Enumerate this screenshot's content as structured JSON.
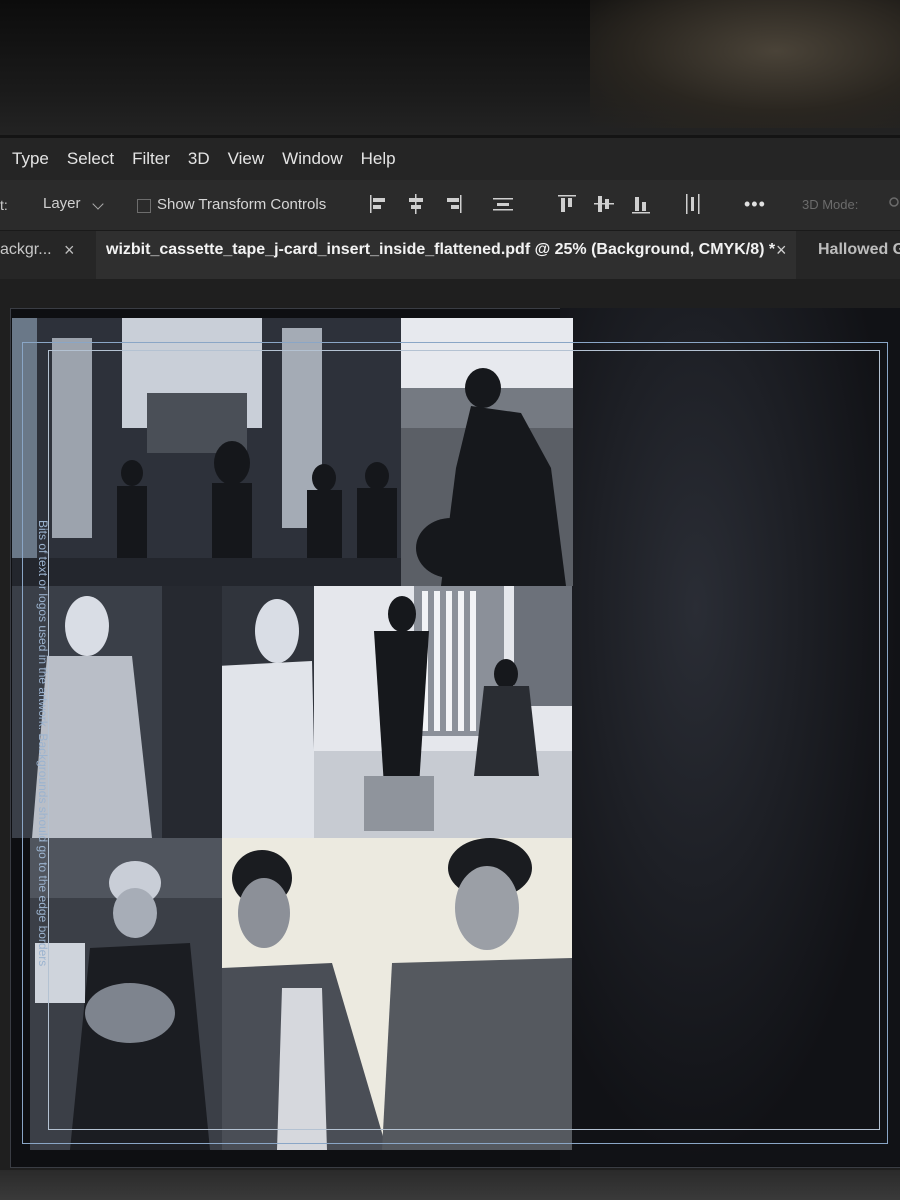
{
  "menu": [
    "Type",
    "Select",
    "Filter",
    "3D",
    "View",
    "Window",
    "Help"
  ],
  "options": {
    "cut_label": "t:",
    "layer_label": "Layer",
    "show_transform_label": "Show Transform Controls",
    "more_label": "•••",
    "mode_label": "3D Mode:"
  },
  "tabs": {
    "prev_label": "ackgr...",
    "active_label": "wizbit_cassette_tape_j-card_insert_inside_flattened.pdf @ 25% (Background, CMYK/8) *",
    "next_label": "Hallowed G",
    "close_glyph": "×"
  },
  "canvas": {
    "guide_note": "Bits of text or logos used in the artwork. Backgrounds should go to the edge borders",
    "colors": {
      "guide": "#8aa6c6",
      "paper_dark": "#0e0f12",
      "photo_tint": "#c9d3e6"
    }
  },
  "icons": {
    "align": [
      "align-left-edges-icon",
      "align-horizontal-centers-icon",
      "align-right-edges-icon",
      "distribute-horizontal-icon",
      "align-top-edges-icon",
      "align-vertical-centers-icon",
      "align-bottom-edges-icon",
      "distribute-vertical-icon"
    ],
    "more": "ellipsis-icon",
    "close": "close-icon"
  }
}
